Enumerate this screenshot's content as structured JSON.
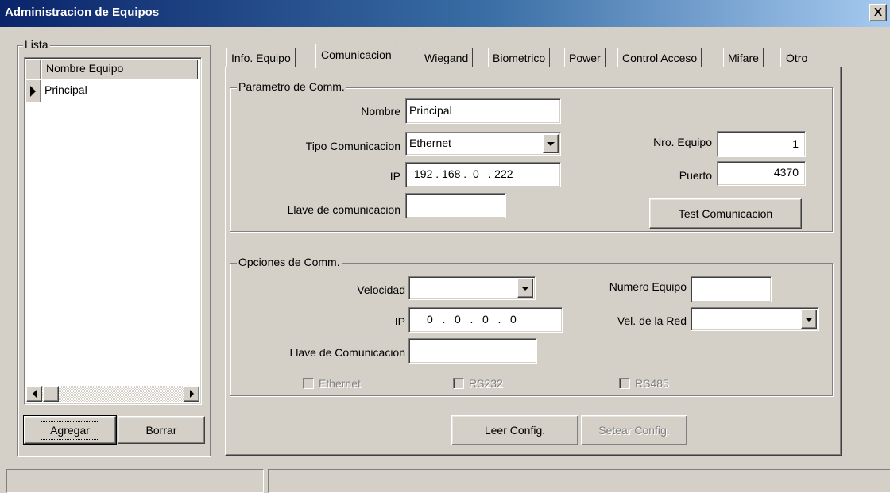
{
  "window": {
    "title": "Administracion de Equipos",
    "close_glyph": "X",
    "titlebar_color_start": "#0a246a",
    "titlebar_color_end": "#a6caf0"
  },
  "lista": {
    "legend": "Lista",
    "column_header": "Nombre Equipo",
    "rows": [
      {
        "label": "Principal",
        "selected": true
      }
    ],
    "add_button": "Agregar",
    "delete_button": "Borrar"
  },
  "tabs": [
    {
      "label": "Info. Equipo",
      "active": false
    },
    {
      "label": "Comunicacion",
      "active": true
    },
    {
      "label": "Wiegand",
      "active": false
    },
    {
      "label": "Biometrico",
      "active": false
    },
    {
      "label": "Power",
      "active": false
    },
    {
      "label": "Control Acceso",
      "active": false
    },
    {
      "label": "Mifare",
      "active": false
    },
    {
      "label": "Otro",
      "active": false
    }
  ],
  "parametro": {
    "legend": "Parametro de Comm.",
    "nombre_label": "Nombre",
    "nombre_value": "Principal",
    "tipo_label": "Tipo Comunicacion",
    "tipo_value": "Ethernet",
    "ip_label": "IP",
    "ip_value": "192 . 168 .  0   . 222",
    "llave_label": "Llave de comunicacion",
    "llave_value": "",
    "nro_equipo_label": "Nro. Equipo",
    "nro_equipo_value": "1",
    "puerto_label": "Puerto",
    "puerto_value": "4370",
    "test_button": "Test Comunicacion"
  },
  "opciones": {
    "legend": "Opciones de Comm.",
    "velocidad_label": "Velocidad",
    "velocidad_value": "",
    "ip_label": "IP",
    "ip_value": "0   .   0   .   0   .   0",
    "llave_label": "Llave de Comunicacion",
    "llave_value": "",
    "numero_equipo_label": "Numero Equipo",
    "numero_equipo_value": "",
    "vel_red_label": "Vel. de la Red",
    "vel_red_value": "",
    "checkboxes": [
      {
        "label": "Ethernet",
        "checked": false
      },
      {
        "label": "RS232",
        "checked": false
      },
      {
        "label": "RS485",
        "checked": false
      }
    ]
  },
  "actions": {
    "leer_button": "Leer Config.",
    "setear_button": "Setear Config."
  }
}
